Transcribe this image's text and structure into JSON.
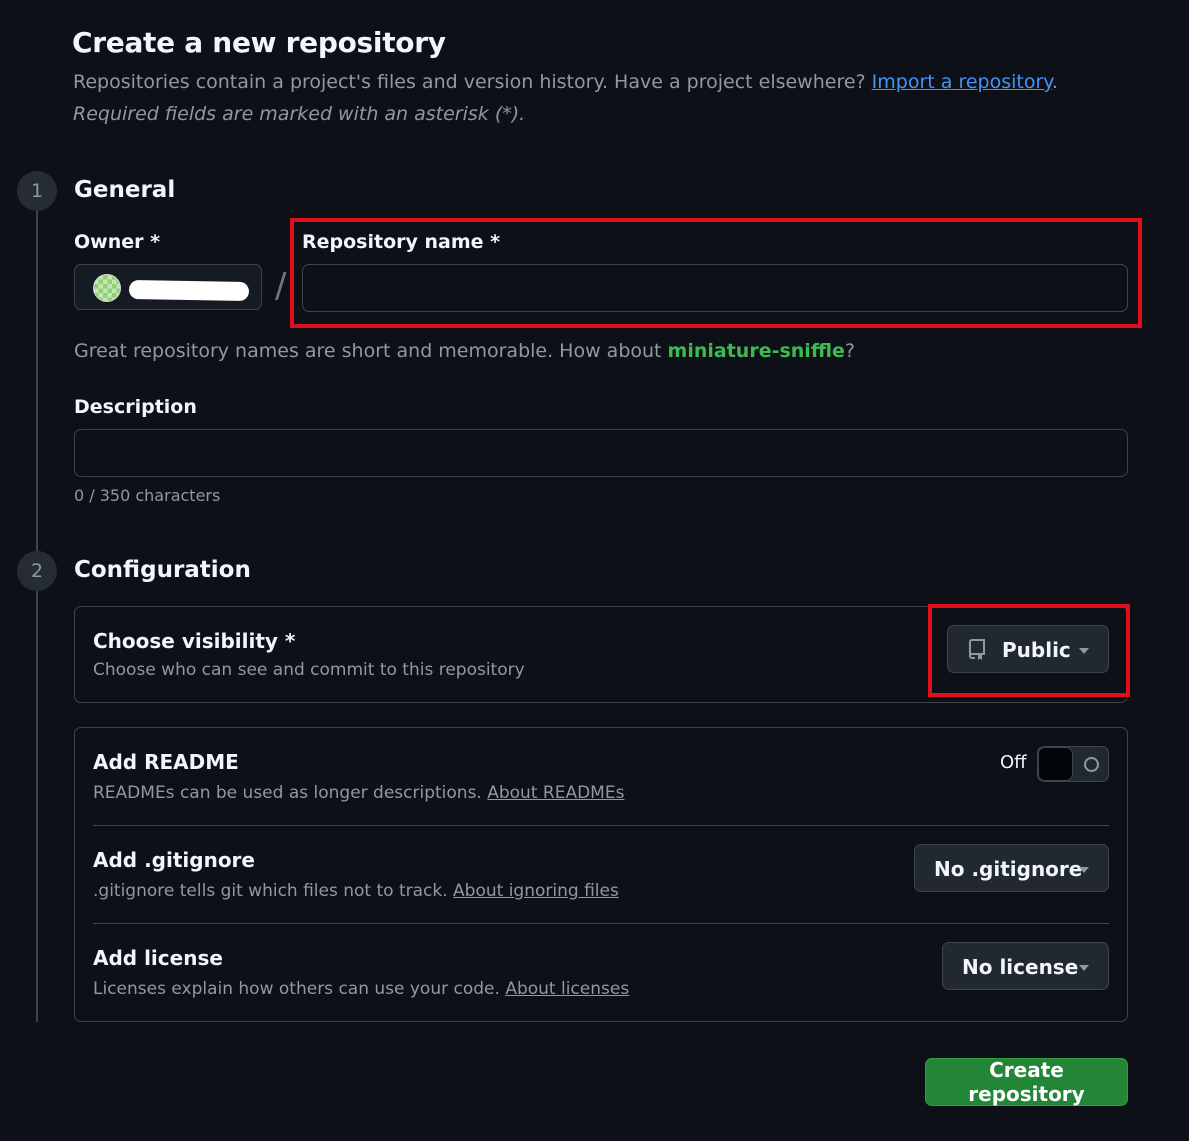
{
  "header": {
    "title": "Create a new repository",
    "subtitle_text": "Repositories contain a project's files and version history. Have a project elsewhere?",
    "import_link": "Import a repository",
    "subtitle_end": ".",
    "required_note": "Required fields are marked with an asterisk (*)."
  },
  "general": {
    "step_number": "1",
    "heading": "General",
    "owner_label": "Owner *",
    "slash": "/",
    "repo_name_label": "Repository name *",
    "repo_name_value": "",
    "hint_prefix": "Great repository names are short and memorable. How about ",
    "hint_suggestion": "miniature-sniffle",
    "hint_suffix": "?",
    "description_label": "Description",
    "description_value": "",
    "char_count": "0 / 350 characters"
  },
  "configuration": {
    "step_number": "2",
    "heading": "Configuration",
    "visibility": {
      "title": "Choose visibility *",
      "description": "Choose who can see and commit to this repository",
      "button_label": "Public",
      "icon": "repo-icon"
    },
    "readme": {
      "title": "Add README",
      "description": "READMEs can be used as longer descriptions.",
      "link": "About READMEs",
      "toggle_label": "Off"
    },
    "gitignore": {
      "title": "Add .gitignore",
      "description": ".gitignore tells git which files not to track.",
      "link": "About ignoring files",
      "button_label": "No .gitignore"
    },
    "license": {
      "title": "Add license",
      "description": "Licenses explain how others can use your code.",
      "link": "About licenses",
      "button_label": "No license"
    }
  },
  "create_button_label": "Create repository",
  "colors": {
    "background": "#0d1117",
    "accent_link": "#4493f8",
    "suggestion_green": "#3fb950",
    "primary_button": "#238636",
    "highlight_red": "#e00f1b"
  }
}
